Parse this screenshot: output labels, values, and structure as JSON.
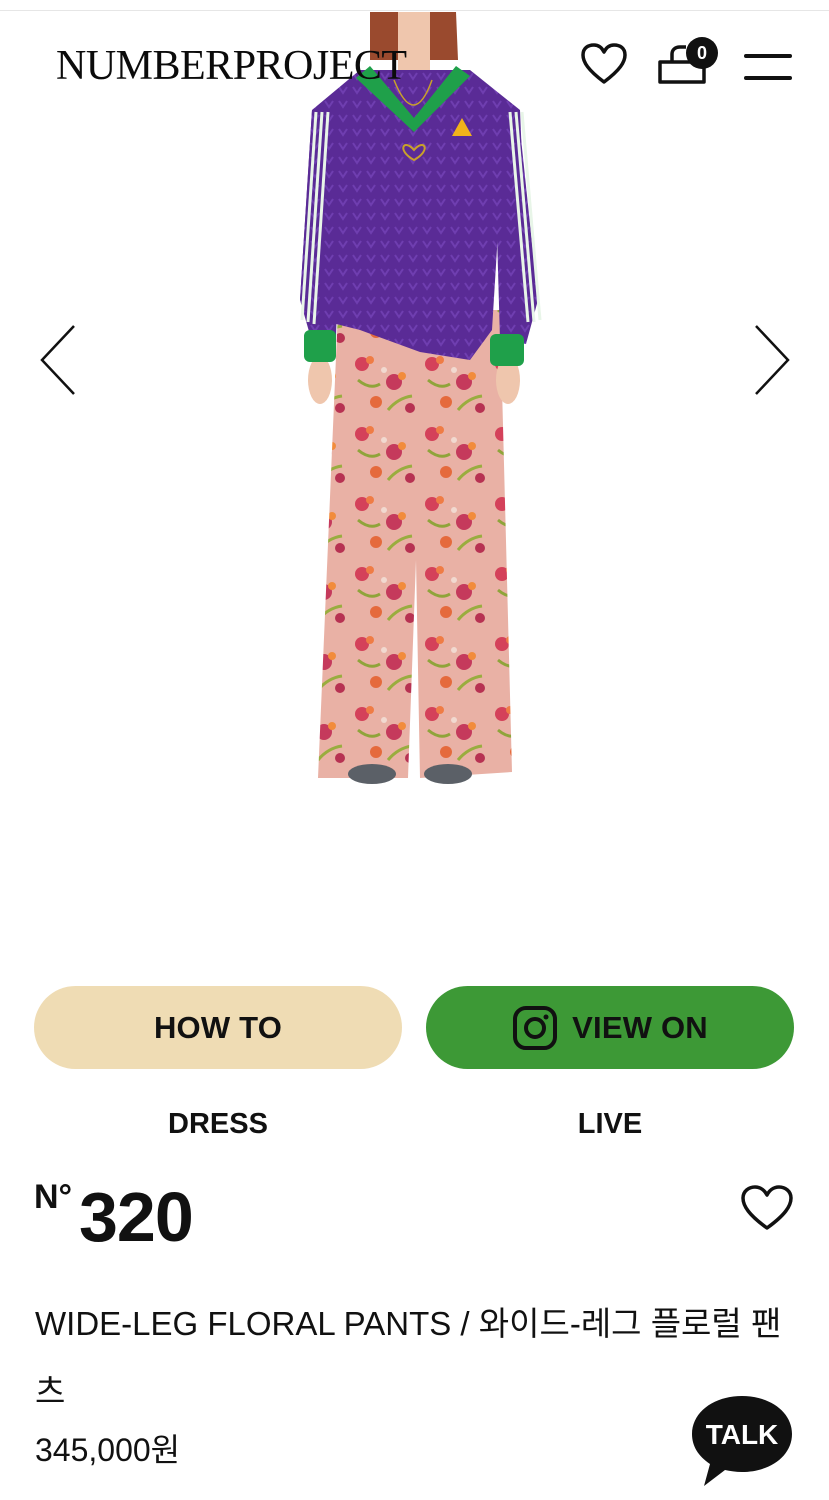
{
  "header": {
    "logo": "NUMBERPROJECT",
    "cart_count": "0",
    "icons": [
      "heart-icon",
      "cart-icon",
      "menu-icon"
    ]
  },
  "gallery": {
    "image_alt": "Model wearing purple jersey top and pink floral wide-leg pants",
    "prev_icon": "chevron-left-icon",
    "next_icon": "chevron-right-icon"
  },
  "buttons": {
    "how_to": "HOW TO",
    "view_on": "VIEW ON",
    "dress": "DRESS",
    "live": "LIVE"
  },
  "product": {
    "number_prefix": "N°",
    "number": "320",
    "title": "WIDE-LEG FLORAL PANTS / 와이드-레그 플로럴 팬츠",
    "price": "345,000원"
  },
  "chat": {
    "label": "TALK"
  },
  "colors": {
    "how_to_bg": "#efdcb4",
    "view_on_bg": "#3d9936",
    "top_purple": "#5a2b96",
    "collar_green": "#1fa04a",
    "pants_pink": "#eab1a6"
  }
}
